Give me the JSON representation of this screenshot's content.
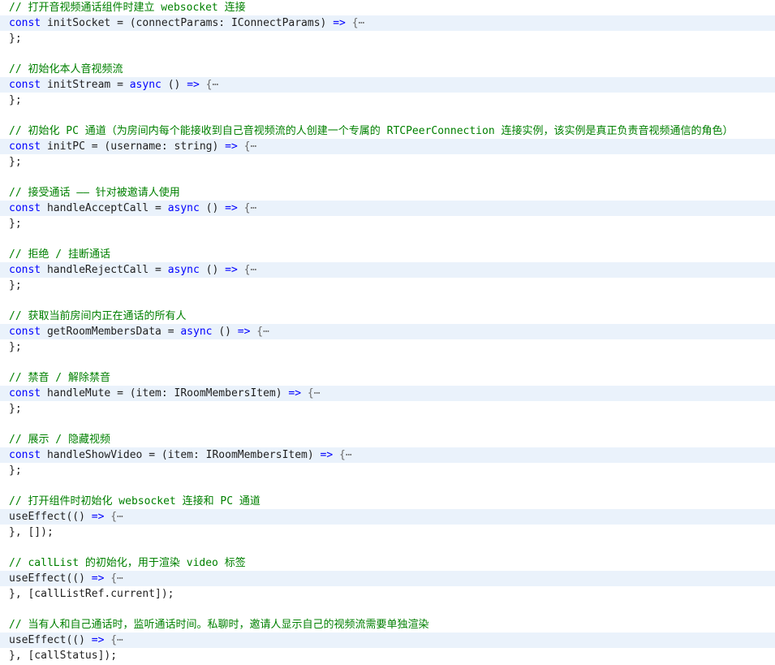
{
  "colors": {
    "comment": "#008000",
    "keyword": "#0000ff",
    "text": "#1f1f1f",
    "fold_highlight": "#eaf2fb",
    "background": "#ffffff"
  },
  "blocks": [
    {
      "comment": "// 打开音视频通话组件时建立 websocket 连接",
      "keyword": "const",
      "name": "initSocket",
      "async": "",
      "params": "(connectParams: IConnectParams)",
      "arrow": "=>",
      "fold": "{⋯",
      "close": "};"
    },
    {
      "comment": "// 初始化本人音视频流",
      "keyword": "const",
      "name": "initStream",
      "async": "async",
      "params": "()",
      "arrow": "=>",
      "fold": "{⋯",
      "close": "};"
    },
    {
      "comment": "// 初始化 PC 通道（为房间内每个能接收到自己音视频流的人创建一个专属的 RTCPeerConnection 连接实例，该实例是真正负责音视频通信的角色）",
      "keyword": "const",
      "name": "initPC",
      "async": "",
      "params": "(username: string)",
      "arrow": "=>",
      "fold": "{⋯",
      "close": "};"
    },
    {
      "comment": "// 接受通话 —— 针对被邀请人使用",
      "keyword": "const",
      "name": "handleAcceptCall",
      "async": "async",
      "params": "()",
      "arrow": "=>",
      "fold": "{⋯",
      "close": "};"
    },
    {
      "comment": "// 拒绝 / 挂断通话",
      "keyword": "const",
      "name": "handleRejectCall",
      "async": "async",
      "params": "()",
      "arrow": "=>",
      "fold": "{⋯",
      "close": "};"
    },
    {
      "comment": "// 获取当前房间内正在通话的所有人",
      "keyword": "const",
      "name": "getRoomMembersData",
      "async": "async",
      "params": "()",
      "arrow": "=>",
      "fold": "{⋯",
      "close": "};"
    },
    {
      "comment": "// 禁音 / 解除禁音",
      "keyword": "const",
      "name": "handleMute",
      "async": "",
      "params": "(item: IRoomMembersItem)",
      "arrow": "=>",
      "fold": "{⋯",
      "close": "};"
    },
    {
      "comment": "// 展示 / 隐藏视频",
      "keyword": "const",
      "name": "handleShowVideo",
      "async": "",
      "params": "(item: IRoomMembersItem)",
      "arrow": "=>",
      "fold": "{⋯",
      "close": "};"
    }
  ],
  "effects": [
    {
      "comment": "// 打开组件时初始化 websocket 连接和 PC 通道",
      "call": "useEffect(()",
      "arrow": "=>",
      "fold": "{⋯",
      "close": "}, []);"
    },
    {
      "comment": "// callList 的初始化，用于渲染 video 标签",
      "call": "useEffect(()",
      "arrow": "=>",
      "fold": "{⋯",
      "close": "}, [callListRef.current]);"
    },
    {
      "comment": "// 当有人和自己通话时，监听通话时间。私聊时，邀请人显示自己的视频流需要单独渲染",
      "call": "useEffect(()",
      "arrow": "=>",
      "fold": "{⋯",
      "close": "}, [callStatus]);"
    }
  ]
}
